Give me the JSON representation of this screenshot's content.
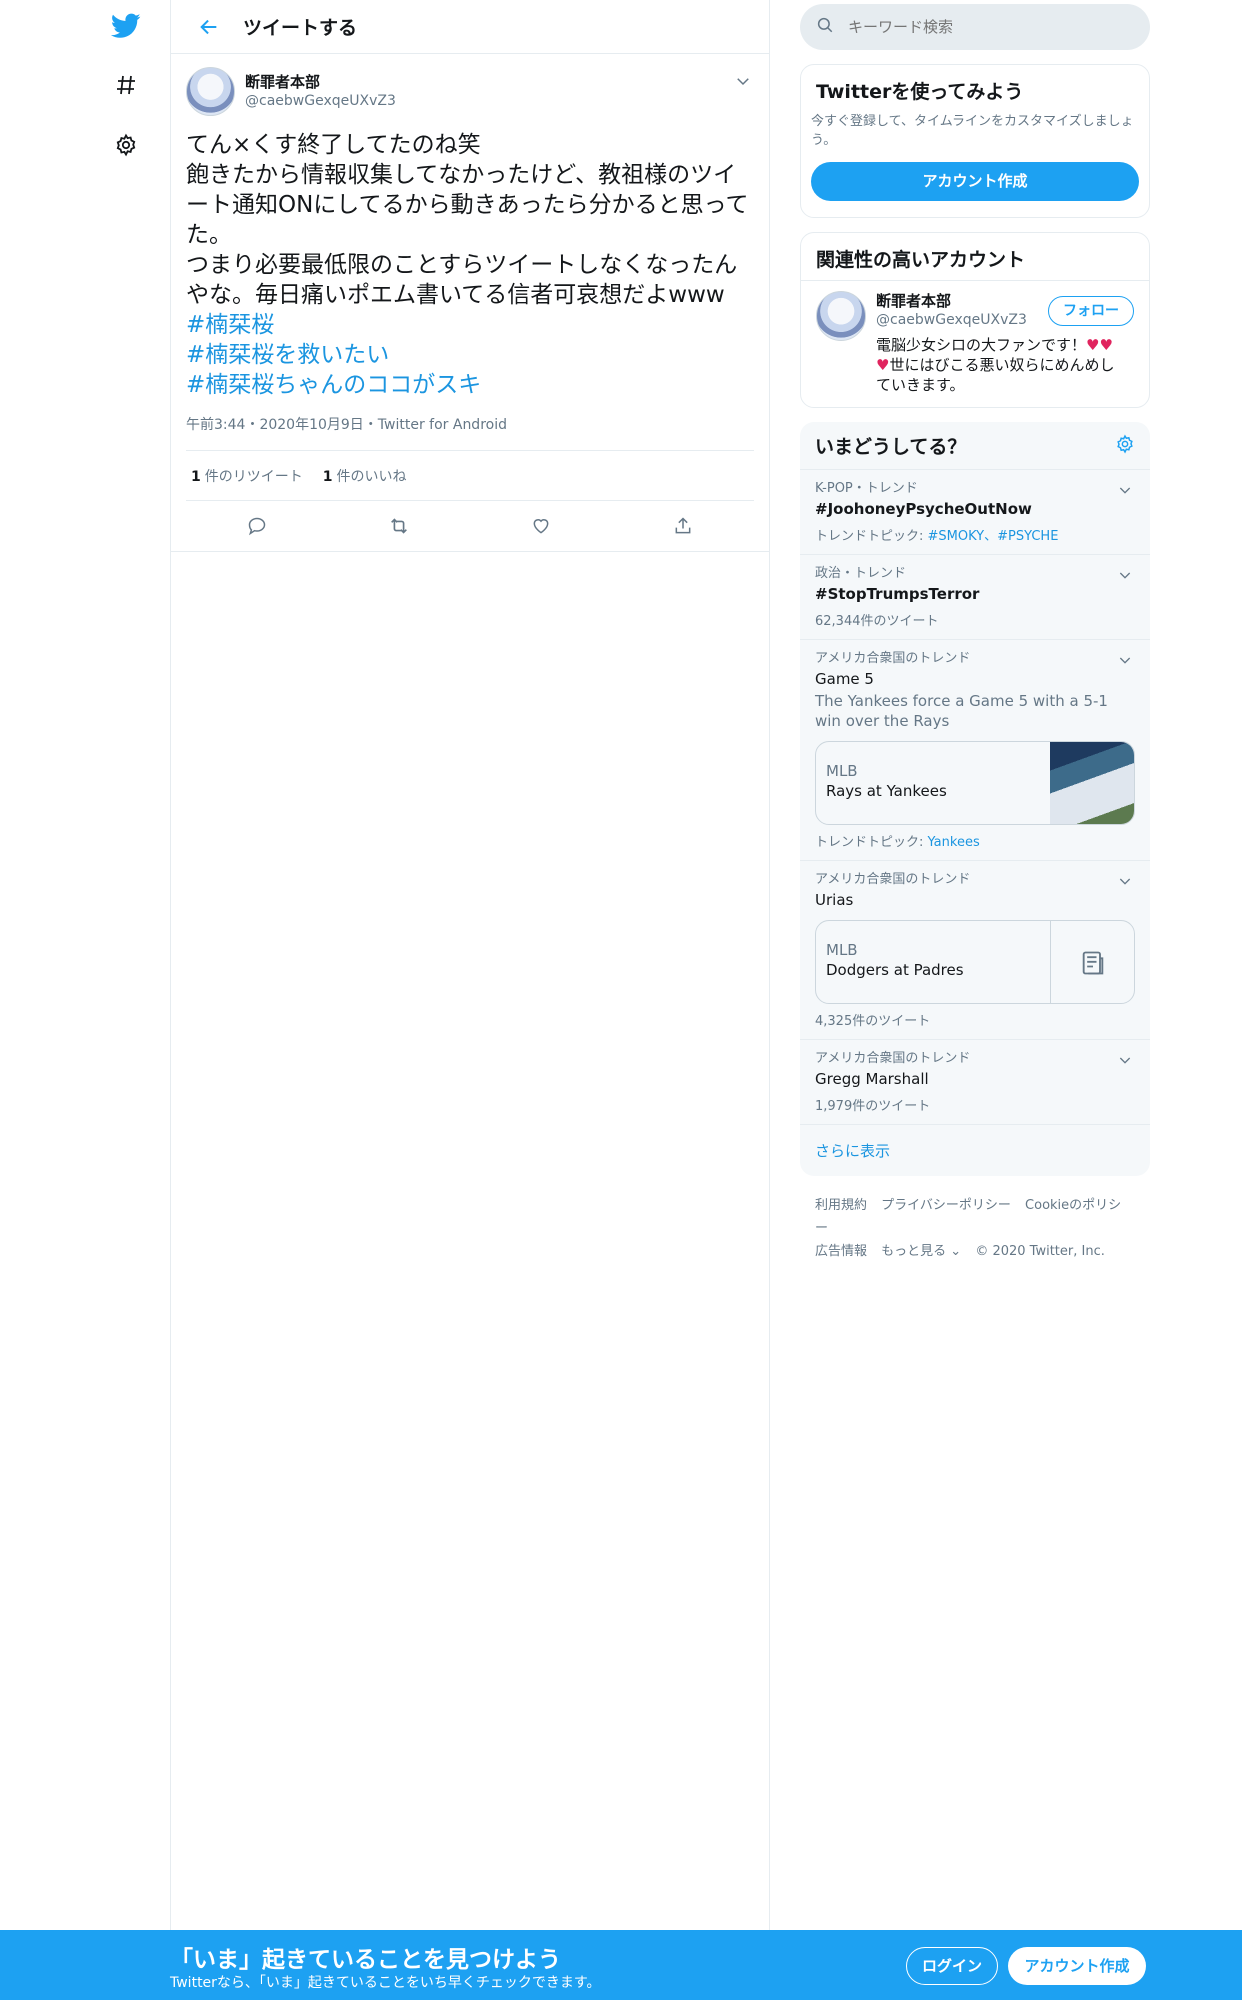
{
  "header": {
    "title": "ツイートする"
  },
  "tweet": {
    "author_name": "断罪者本部",
    "author_handle": "@caebwGexqeUXvZ3",
    "text": "てん×くす終了してたのね笑\n飽きたから情報収集してなかったけど、教祖様のツイート通知ONにしてるから動きあったら分かると思ってた。\nつまり必要最低限のことすらツイートしなくなったんやな。毎日痛いポエム書いてる信者可哀想だよwww",
    "hashtags": [
      "#楠栞桜",
      "#楠栞桜を救いたい",
      "#楠栞桜ちゃんのココがスキ"
    ],
    "meta": "午前3:44・2020年10月9日・Twitter for Android",
    "retweet_count": "1",
    "retweet_label": "件のリツイート",
    "like_count": "1",
    "like_label": "件のいいね"
  },
  "search": {
    "placeholder": "キーワード検索"
  },
  "signup_card": {
    "title": "Twitterを使ってみよう",
    "desc": "今すぐ登録して、タイムラインをカスタマイズしましょう。",
    "button": "アカウント作成"
  },
  "related": {
    "title": "関連性の高いアカウント",
    "name": "断罪者本部",
    "handle": "@caebwGexqeUXvZ3",
    "follow": "フォロー",
    "bio_1": "電脳少女シロの大ファンです！",
    "bio_hearts_1": "♥♥",
    "bio_hearts_2": "♥",
    "bio_2": "世にはびこる悪い奴らにめんめしていきます。"
  },
  "trends": {
    "title": "いまどうしてる？",
    "items": [
      {
        "context": "K-POP・トレンド",
        "name": "#JoohoneyPsycheOutNow",
        "sub_label": "トレンドトピック:",
        "sub_links": "#SMOKY、#PSYCHE"
      },
      {
        "context": "政治・トレンド",
        "name": "#StopTrumpsTerror",
        "count": "62,344件のツイート"
      },
      {
        "context": "アメリカ合衆国のトレンド",
        "name": "Game 5",
        "desc": "The Yankees force a Game 5 with a 5-1 win over the Rays",
        "event_cat": "MLB",
        "event_title": "Rays at Yankees",
        "sub_label": "トレンドトピック:",
        "sub_links": "Yankees"
      },
      {
        "context": "アメリカ合衆国のトレンド",
        "name": "Urias",
        "event_cat": "MLB",
        "event_title": "Dodgers at Padres",
        "count": "4,325件のツイート"
      },
      {
        "context": "アメリカ合衆国のトレンド",
        "name": "Gregg Marshall",
        "count": "1,979件のツイート"
      }
    ],
    "show_more": "さらに表示"
  },
  "footer": {
    "links_1": [
      "利用規約",
      "プライバシーポリシー",
      "Cookieのポリシー"
    ],
    "links_2": [
      "広告情報",
      "もっと見る ⌄"
    ],
    "copyright": "© 2020 Twitter, Inc."
  },
  "bottombar": {
    "title": "「いま」起きていることを見つけよう",
    "sub": "Twitterなら、「いま」起きていることをいち早くチェックできます。",
    "login": "ログイン",
    "signup": "アカウント作成"
  },
  "colors": {
    "accent": "#1da1f2",
    "link": "#1b95e0",
    "heart": "#e0245e"
  }
}
